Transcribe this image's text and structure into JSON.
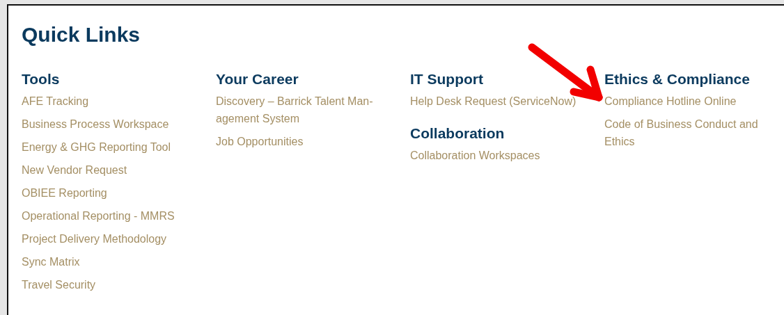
{
  "title": "Quick Links",
  "columns": [
    {
      "sections": [
        {
          "heading": "Tools",
          "links": [
            "AFE Tracking",
            "Business Process Workspace",
            "Energy & GHG Reporting Tool",
            "New Vendor Request",
            "OBIEE Reporting",
            "Operational Reporting - MMRS",
            "Project Delivery Methodology",
            "Sync Matrix",
            "Travel Security"
          ]
        }
      ]
    },
    {
      "sections": [
        {
          "heading": "Your Career",
          "links": [
            "Discovery – Barrick Talent Man-agement System",
            "Job Opportunities"
          ]
        }
      ]
    },
    {
      "sections": [
        {
          "heading": "IT Support",
          "links": [
            "Help Desk Request (ServiceNow)"
          ]
        },
        {
          "heading": "Collaboration",
          "links": [
            "Collaboration Workspaces"
          ]
        }
      ]
    },
    {
      "sections": [
        {
          "heading": "Ethics & Compliance",
          "links": [
            "Compliance Hotline Online",
            "Code of Business Conduct and Ethics"
          ]
        }
      ]
    }
  ]
}
